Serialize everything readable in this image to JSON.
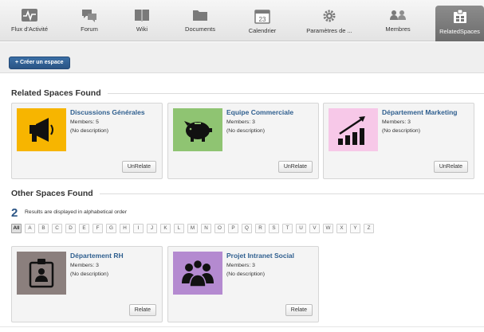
{
  "nav": [
    {
      "id": "flux",
      "label": "Flux d'Activité",
      "icon": "activity-stream-icon"
    },
    {
      "id": "forum",
      "label": "Forum",
      "icon": "forum-icon"
    },
    {
      "id": "wiki",
      "label": "Wiki",
      "icon": "wiki-book-icon"
    },
    {
      "id": "documents",
      "label": "Documents",
      "icon": "folder-icon"
    },
    {
      "id": "calendrier",
      "label": "Calendrier",
      "icon": "calendar-icon"
    },
    {
      "id": "parametres",
      "label": "Paramètres de ...",
      "icon": "gear-icon"
    },
    {
      "id": "membres",
      "label": "Membres",
      "icon": "members-icon"
    },
    {
      "id": "related",
      "label": "RelatedSpaces",
      "icon": "related-spaces-icon",
      "active": true
    }
  ],
  "calendar_day": "23",
  "toolbar": {
    "create_label": "+ Créer un espace"
  },
  "related": {
    "title": "Related Spaces Found",
    "cards": [
      {
        "name": "Discussions Générales",
        "members": "Members: 5",
        "desc": "(No description)",
        "button": "UnRelate",
        "icon": "megaphone-icon",
        "bg": "#f7b500"
      },
      {
        "name": "Equipe Commerciale",
        "members": "Members: 3",
        "desc": "(No description)",
        "button": "UnRelate",
        "icon": "piggy-bank-icon",
        "bg": "#8fc472"
      },
      {
        "name": "Département Marketing",
        "members": "Members: 3",
        "desc": "(No description)",
        "button": "UnRelate",
        "icon": "growth-chart-icon",
        "bg": "#f7c8e8"
      }
    ]
  },
  "other": {
    "title": "Other Spaces Found",
    "count": "2",
    "note": "Results are displayed in alphabetical order",
    "letters": [
      "All",
      "A",
      "B",
      "C",
      "D",
      "E",
      "F",
      "G",
      "H",
      "I",
      "J",
      "K",
      "L",
      "M",
      "N",
      "O",
      "P",
      "Q",
      "R",
      "S",
      "T",
      "U",
      "V",
      "W",
      "X",
      "Y",
      "Z"
    ],
    "selected": "All",
    "cards": [
      {
        "name": "Département RH",
        "members": "Members: 3",
        "desc": "(No description)",
        "button": "Relate",
        "icon": "id-badge-icon",
        "bg": "#8b7f7d"
      },
      {
        "name": "Projet Intranet Social",
        "members": "Members: 3",
        "desc": "(No description)",
        "button": "Relate",
        "icon": "group-people-icon",
        "bg": "#b48ad0"
      }
    ]
  }
}
